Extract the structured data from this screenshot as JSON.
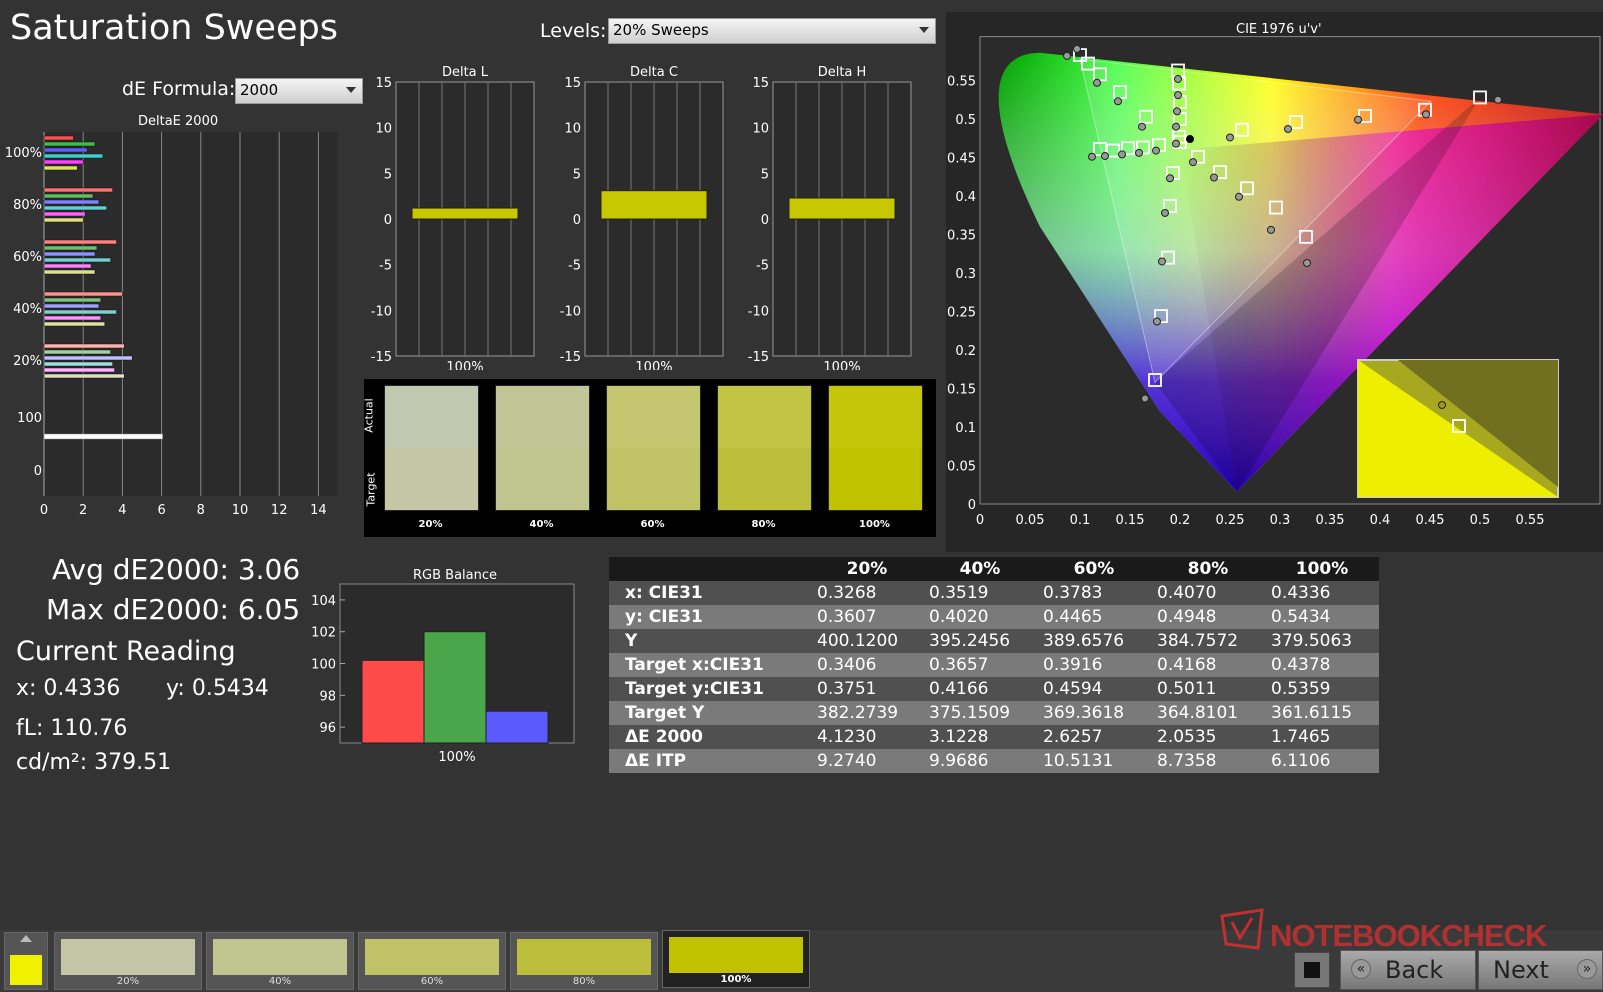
{
  "title": "Saturation Sweeps",
  "levels": {
    "label": "Levels:",
    "value": "20% Sweeps"
  },
  "de_formula": {
    "label": "dE Formula:",
    "value": "2000"
  },
  "deltae_chart": {
    "title": "DeltaE 2000",
    "y_ticks": [
      "100%",
      "80%",
      "60%",
      "40%",
      "20%",
      "100",
      "0"
    ],
    "x_ticks": [
      "0",
      "2",
      "4",
      "6",
      "8",
      "10",
      "12",
      "14"
    ],
    "groups": [
      {
        "label": "100%",
        "values": [
          1.5,
          2.6,
          2.2,
          3.0,
          2.0,
          1.7
        ],
        "colors": [
          "#ff5050",
          "#40c040",
          "#6060ff",
          "#40d0d0",
          "#ff40ff",
          "#e0e060"
        ]
      },
      {
        "label": "80%",
        "values": [
          3.5,
          2.5,
          2.8,
          3.2,
          2.1,
          2.0
        ],
        "colors": [
          "#ff7070",
          "#60c060",
          "#8080ff",
          "#60d0d0",
          "#ff60ff",
          "#e0e080"
        ]
      },
      {
        "label": "60%",
        "values": [
          3.7,
          2.7,
          2.6,
          3.4,
          2.4,
          2.6
        ],
        "colors": [
          "#ff8080",
          "#70c070",
          "#9090ff",
          "#70d0d0",
          "#ff80ff",
          "#e0e090"
        ]
      },
      {
        "label": "40%",
        "values": [
          4.0,
          2.9,
          2.8,
          3.7,
          2.9,
          3.1
        ],
        "colors": [
          "#ff9090",
          "#80c080",
          "#a0a0ff",
          "#80d0d0",
          "#ff90ff",
          "#e0e0a0"
        ]
      },
      {
        "label": "20%",
        "values": [
          4.1,
          3.4,
          4.5,
          3.5,
          3.6,
          4.1
        ],
        "colors": [
          "#ffb0b0",
          "#a0d0a0",
          "#c0c0ff",
          "#a0e0e0",
          "#ffb0ff",
          "#e0e0c0"
        ]
      },
      {
        "label": "100",
        "values": [
          6.05
        ],
        "colors": [
          "#ffffff"
        ]
      }
    ]
  },
  "delta_l": {
    "title": "Delta L",
    "value": 1.2,
    "xlabel": "100%"
  },
  "delta_c": {
    "title": "Delta C",
    "value": 3.1,
    "xlabel": "100%"
  },
  "delta_h": {
    "title": "Delta H",
    "value": 2.3,
    "xlabel": "100%"
  },
  "delta_ticks": [
    "15",
    "10",
    "5",
    "0",
    "-5",
    "-10",
    "-15"
  ],
  "swatches": {
    "actual_label": "Actual",
    "target_label": "Target",
    "items": [
      {
        "label": "20%",
        "actual": "#c0c8b0",
        "target": "#c4c6a6"
      },
      {
        "label": "40%",
        "actual": "#c0c698",
        "target": "#c0c48e"
      },
      {
        "label": "60%",
        "actual": "#c4c670",
        "target": "#c0c266"
      },
      {
        "label": "80%",
        "actual": "#c2c444",
        "target": "#bcbd3a"
      },
      {
        "label": "100%",
        "actual": "#c6c608",
        "target": "#c0c200"
      }
    ]
  },
  "cie": {
    "title": "CIE 1976 u'v'",
    "x_ticks": [
      "0",
      "0.05",
      "0.1",
      "0.15",
      "0.2",
      "0.25",
      "0.3",
      "0.35",
      "0.4",
      "0.45",
      "0.5",
      "0.55"
    ],
    "y_ticks": [
      "0.55",
      "0.5",
      "0.45",
      "0.4",
      "0.35",
      "0.3",
      "0.25",
      "0.2",
      "0.15",
      "0.1",
      "0.05",
      "0"
    ]
  },
  "stats": {
    "avg": "Avg dE2000: 3.06",
    "max": "Max dE2000: 6.05"
  },
  "current": {
    "heading": "Current Reading",
    "x": "x: 0.4336",
    "y": "y: 0.5434",
    "fl": "fL: 110.76",
    "cdm": "cd/m²: 379.51"
  },
  "rgb_balance": {
    "title": "RGB Balance",
    "y_ticks": [
      "104",
      "102",
      "100",
      "98",
      "96"
    ],
    "ylim": [
      95,
      105
    ],
    "xlabel": "100%",
    "values": [
      100.2,
      102.0,
      97.0
    ],
    "colors": [
      "#ff4a4a",
      "#4aa64a",
      "#5a5aff"
    ]
  },
  "table": {
    "headers": [
      "",
      "20%",
      "40%",
      "60%",
      "80%",
      "100%"
    ],
    "rows": [
      [
        "x: CIE31",
        "0.3268",
        "0.3519",
        "0.3783",
        "0.4070",
        "0.4336"
      ],
      [
        "y: CIE31",
        "0.3607",
        "0.4020",
        "0.4465",
        "0.4948",
        "0.5434"
      ],
      [
        "Y",
        "400.1200",
        "395.2456",
        "389.6576",
        "384.7572",
        "379.5063"
      ],
      [
        "Target x:CIE31",
        "0.3406",
        "0.3657",
        "0.3916",
        "0.4168",
        "0.4378"
      ],
      [
        "Target y:CIE31",
        "0.3751",
        "0.4166",
        "0.4594",
        "0.5011",
        "0.5359"
      ],
      [
        "Target Y",
        "382.2739",
        "375.1509",
        "369.3618",
        "364.8101",
        "361.6115"
      ],
      [
        "ΔE 2000",
        "4.1230",
        "3.1228",
        "2.6257",
        "2.0535",
        "1.7465"
      ],
      [
        "ΔE ITP",
        "9.2740",
        "9.9686",
        "10.5131",
        "8.7358",
        "6.1106"
      ]
    ]
  },
  "thumbs": [
    {
      "label": "20%",
      "color": "#c4c6a6"
    },
    {
      "label": "40%",
      "color": "#c0c48e"
    },
    {
      "label": "60%",
      "color": "#c0c266"
    },
    {
      "label": "80%",
      "color": "#bcbd3a"
    },
    {
      "label": "100%",
      "color": "#c0c200"
    }
  ],
  "nav": {
    "back": "Back",
    "next": "Next"
  },
  "watermark": "NOTEBOOKCHECK"
}
